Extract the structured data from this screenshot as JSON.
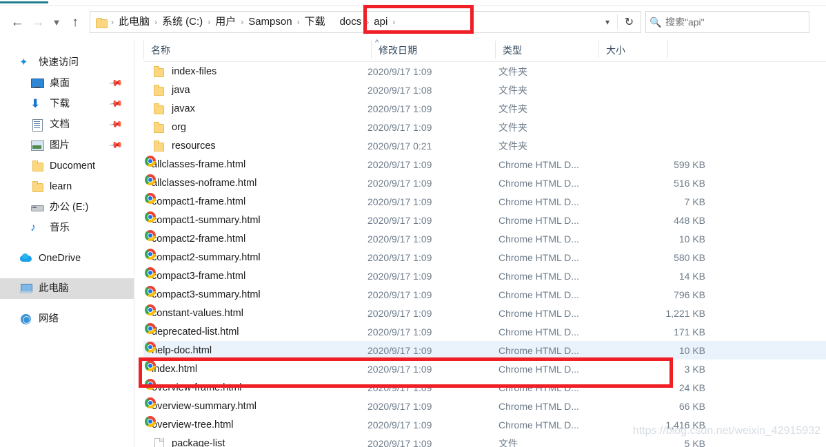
{
  "toolbar": {
    "back_icon": "arrow-left-icon",
    "forward_icon": "arrow-right-icon",
    "recent_icon": "chevron-down-icon",
    "up_icon": "arrow-up-icon",
    "refresh_icon": "refresh-icon",
    "address_chevron_icon": "chevron-down-icon"
  },
  "address": {
    "folder_icon": "folder-icon",
    "crumbs": [
      {
        "label": "此电脑"
      },
      {
        "label": "系统 (C:)"
      },
      {
        "label": "用户"
      },
      {
        "label": "Sampson"
      },
      {
        "label": "下载"
      },
      {
        "label": "docs"
      },
      {
        "label": "api"
      }
    ],
    "separator": "›"
  },
  "search": {
    "icon": "search-icon",
    "placeholder": "搜索\"api\"",
    "value": ""
  },
  "columns": {
    "name": "名称",
    "date": "修改日期",
    "type": "类型",
    "size": "大小",
    "sort_caret": "^"
  },
  "sidebar": {
    "items": [
      {
        "label": "快速访问",
        "icon": "star-pin-icon",
        "indent": false,
        "pinned": false,
        "selected": false
      },
      {
        "label": "桌面",
        "icon": "desktop-icon",
        "indent": true,
        "pinned": true,
        "selected": false
      },
      {
        "label": "下载",
        "icon": "download-icon",
        "indent": true,
        "pinned": true,
        "selected": false
      },
      {
        "label": "文档",
        "icon": "document-icon",
        "indent": true,
        "pinned": true,
        "selected": false
      },
      {
        "label": "图片",
        "icon": "pictures-icon",
        "indent": true,
        "pinned": true,
        "selected": false
      },
      {
        "label": "Ducoment",
        "icon": "folder-icon",
        "indent": true,
        "pinned": false,
        "selected": false
      },
      {
        "label": "learn",
        "icon": "folder-icon",
        "indent": true,
        "pinned": false,
        "selected": false
      },
      {
        "label": "办公 (E:)",
        "icon": "drive-icon",
        "indent": true,
        "pinned": false,
        "selected": false
      },
      {
        "label": "音乐",
        "icon": "music-icon",
        "indent": true,
        "pinned": false,
        "selected": false
      },
      {
        "label": "OneDrive",
        "icon": "onedrive-icon",
        "indent": false,
        "pinned": false,
        "selected": false
      },
      {
        "label": "此电脑",
        "icon": "this-pc-icon",
        "indent": false,
        "pinned": false,
        "selected": true
      },
      {
        "label": "网络",
        "icon": "network-icon",
        "indent": false,
        "pinned": false,
        "selected": false
      }
    ]
  },
  "files": {
    "rows": [
      {
        "name": "index-files",
        "date": "2020/9/17 1:09",
        "type": "文件夹",
        "size": "",
        "icon": "folder-icon",
        "hover": false
      },
      {
        "name": "java",
        "date": "2020/9/17 1:08",
        "type": "文件夹",
        "size": "",
        "icon": "folder-icon",
        "hover": false
      },
      {
        "name": "javax",
        "date": "2020/9/17 1:09",
        "type": "文件夹",
        "size": "",
        "icon": "folder-icon",
        "hover": false
      },
      {
        "name": "org",
        "date": "2020/9/17 1:09",
        "type": "文件夹",
        "size": "",
        "icon": "folder-icon",
        "hover": false
      },
      {
        "name": "resources",
        "date": "2020/9/17 0:21",
        "type": "文件夹",
        "size": "",
        "icon": "folder-icon",
        "hover": false
      },
      {
        "name": "allclasses-frame.html",
        "date": "2020/9/17 1:09",
        "type": "Chrome HTML D...",
        "size": "599 KB",
        "icon": "chrome-icon",
        "hover": false
      },
      {
        "name": "allclasses-noframe.html",
        "date": "2020/9/17 1:09",
        "type": "Chrome HTML D...",
        "size": "516 KB",
        "icon": "chrome-icon",
        "hover": false
      },
      {
        "name": "compact1-frame.html",
        "date": "2020/9/17 1:09",
        "type": "Chrome HTML D...",
        "size": "7 KB",
        "icon": "chrome-icon",
        "hover": false
      },
      {
        "name": "compact1-summary.html",
        "date": "2020/9/17 1:09",
        "type": "Chrome HTML D...",
        "size": "448 KB",
        "icon": "chrome-icon",
        "hover": false
      },
      {
        "name": "compact2-frame.html",
        "date": "2020/9/17 1:09",
        "type": "Chrome HTML D...",
        "size": "10 KB",
        "icon": "chrome-icon",
        "hover": false
      },
      {
        "name": "compact2-summary.html",
        "date": "2020/9/17 1:09",
        "type": "Chrome HTML D...",
        "size": "580 KB",
        "icon": "chrome-icon",
        "hover": false
      },
      {
        "name": "compact3-frame.html",
        "date": "2020/9/17 1:09",
        "type": "Chrome HTML D...",
        "size": "14 KB",
        "icon": "chrome-icon",
        "hover": false
      },
      {
        "name": "compact3-summary.html",
        "date": "2020/9/17 1:09",
        "type": "Chrome HTML D...",
        "size": "796 KB",
        "icon": "chrome-icon",
        "hover": false
      },
      {
        "name": "constant-values.html",
        "date": "2020/9/17 1:09",
        "type": "Chrome HTML D...",
        "size": "1,221 KB",
        "icon": "chrome-icon",
        "hover": false
      },
      {
        "name": "deprecated-list.html",
        "date": "2020/9/17 1:09",
        "type": "Chrome HTML D...",
        "size": "171 KB",
        "icon": "chrome-icon",
        "hover": false
      },
      {
        "name": "help-doc.html",
        "date": "2020/9/17 1:09",
        "type": "Chrome HTML D...",
        "size": "10 KB",
        "icon": "chrome-icon",
        "hover": true
      },
      {
        "name": "index.html",
        "date": "2020/9/17 1:09",
        "type": "Chrome HTML D...",
        "size": "3 KB",
        "icon": "chrome-icon",
        "hover": false
      },
      {
        "name": "overview-frame.html",
        "date": "2020/9/17 1:09",
        "type": "Chrome HTML D...",
        "size": "24 KB",
        "icon": "chrome-icon",
        "hover": false
      },
      {
        "name": "overview-summary.html",
        "date": "2020/9/17 1:09",
        "type": "Chrome HTML D...",
        "size": "66 KB",
        "icon": "chrome-icon",
        "hover": false
      },
      {
        "name": "overview-tree.html",
        "date": "2020/9/17 1:09",
        "type": "Chrome HTML D...",
        "size": "1,416 KB",
        "icon": "chrome-icon",
        "hover": false
      },
      {
        "name": "package-list",
        "date": "2020/9/17 1:09",
        "type": "文件",
        "size": "5 KB",
        "icon": "text-file-icon",
        "hover": false
      }
    ]
  },
  "annotations": {
    "breadcrumb_box": "red-rectangle-highlight",
    "index_row_box": "red-rectangle-highlight",
    "accent_red": "#f01f26",
    "selection_blue": "#eaf3fb",
    "watermark": "https://blog.csdn.net/weixin_42915932"
  }
}
